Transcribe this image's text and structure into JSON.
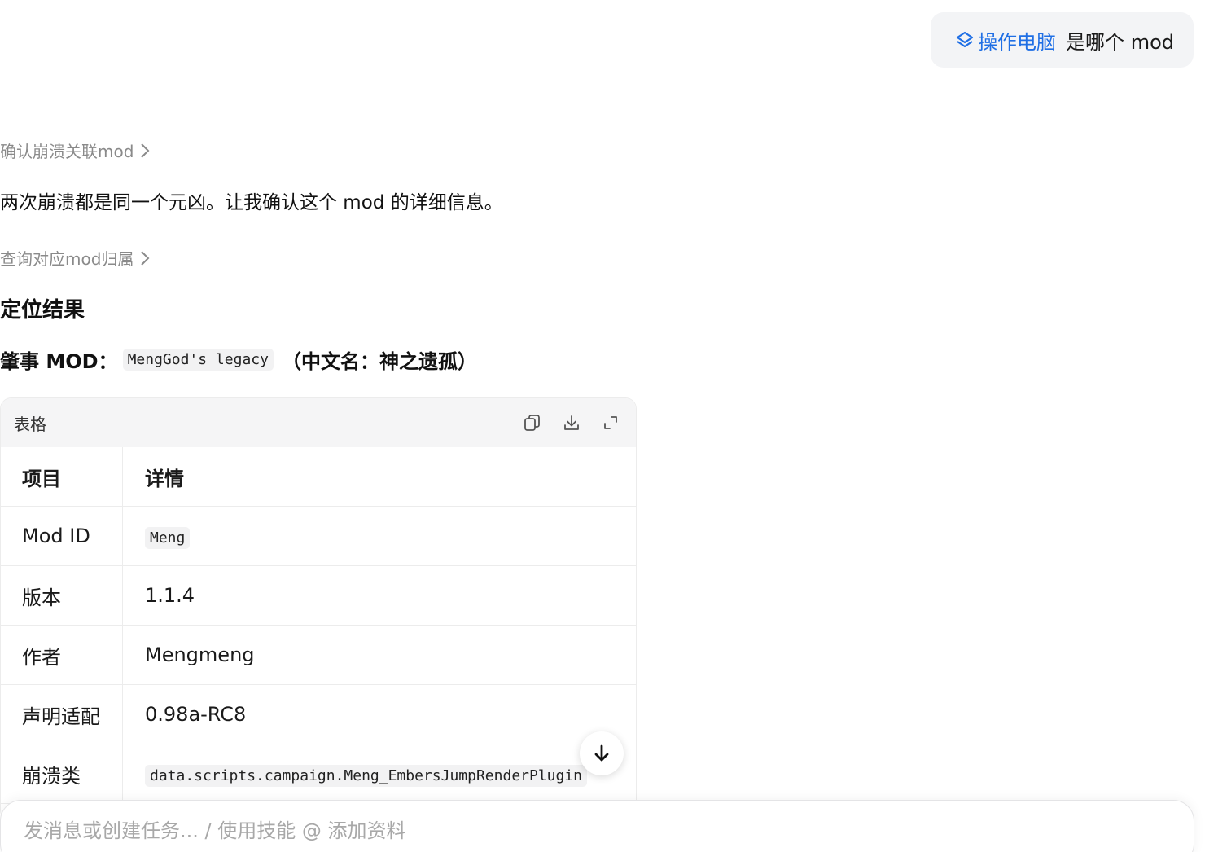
{
  "user_message": {
    "skill_label": "操作电脑",
    "text": "是哪个 mod"
  },
  "steps": {
    "step1": "确认崩溃关联mod",
    "step2": "查询对应mod归属"
  },
  "response": {
    "paragraph": "两次崩溃都是同一个元凶。让我确认这个 mod 的详细信息。",
    "heading": "定位结果",
    "culprit_prefix": "肇事 MOD：",
    "culprit_mod": "MengGod's legacy",
    "culprit_cn": "（中文名：神之遗孤）"
  },
  "table": {
    "label": "表格",
    "headers": [
      "项目",
      "详情"
    ],
    "rows": [
      {
        "key": "Mod ID",
        "value": "Meng",
        "code": true
      },
      {
        "key": "版本",
        "value": "1.1.4",
        "code": false
      },
      {
        "key": "作者",
        "value": "Mengmeng",
        "code": false
      },
      {
        "key": "声明适配",
        "value": "0.98a-RC8",
        "code": false
      },
      {
        "key": "崩溃类",
        "value": "data.scripts.campaign.Meng_EmbersJumpRenderPlugin",
        "code": true
      }
    ]
  },
  "input": {
    "placeholder": "发消息或创建任务... / 使用技能 @ 添加资料"
  },
  "colors": {
    "accent": "#1f6fe5",
    "muted": "#8a8a8a",
    "bubble_bg": "#f3f4f6"
  }
}
